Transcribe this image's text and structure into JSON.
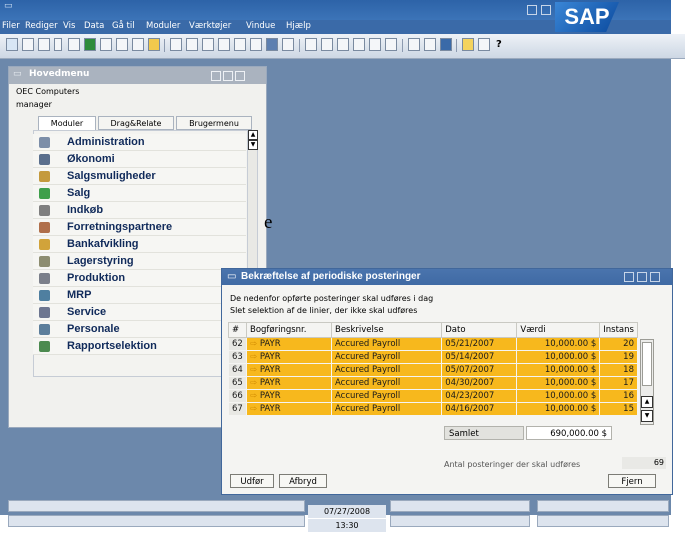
{
  "menubar": [
    "Filer",
    "Rediger",
    "Vis",
    "Data",
    "Gå til",
    "Moduler",
    "Værktøjer",
    "Vindue",
    "Hjælp"
  ],
  "brand": "SAP",
  "main_menu": {
    "title": "Hovedmenu",
    "company": "OEC Computers",
    "user": "manager",
    "tabs": [
      "Moduler",
      "Drag&Relate",
      "Brugermenu"
    ],
    "items": [
      "Administration",
      "Økonomi",
      "Salgsmuligheder",
      "Salg",
      "Indkøb",
      "Forretningspartnere",
      "Bankafvikling",
      "Lagerstyring",
      "Produktion",
      "MRP",
      "Service",
      "Personale",
      "Rapportselektion"
    ]
  },
  "edge_char": "e",
  "dialog": {
    "title": "Bekræftelse af periodiske posteringer",
    "line1": "De nedenfor opførte posteringer skal udføres i dag",
    "line2": "Slet selektion af de linier, der ikke skal udføres",
    "columns": [
      "#",
      "Bogføringsnr.",
      "Beskrivelse",
      "Dato",
      "Værdi",
      "Instans"
    ],
    "rows": [
      {
        "num": "62",
        "code": "PAYR",
        "desc": "Accured Payroll",
        "date": "05/21/2007",
        "value": "10,000.00 $",
        "inst": "20"
      },
      {
        "num": "63",
        "code": "PAYR",
        "desc": "Accured Payroll",
        "date": "05/14/2007",
        "value": "10,000.00 $",
        "inst": "19"
      },
      {
        "num": "64",
        "code": "PAYR",
        "desc": "Accured Payroll",
        "date": "05/07/2007",
        "value": "10,000.00 $",
        "inst": "18"
      },
      {
        "num": "65",
        "code": "PAYR",
        "desc": "Accured Payroll",
        "date": "04/30/2007",
        "value": "10,000.00 $",
        "inst": "17"
      },
      {
        "num": "66",
        "code": "PAYR",
        "desc": "Accured Payroll",
        "date": "04/23/2007",
        "value": "10,000.00 $",
        "inst": "16"
      },
      {
        "num": "67",
        "code": "PAYR",
        "desc": "Accured Payroll",
        "date": "04/16/2007",
        "value": "10,000.00 $",
        "inst": "15"
      }
    ],
    "total_label": "Samlet",
    "total_value": "690,000.00 $",
    "count_label": "Antal posteringer der skal udføres",
    "count_value": "69",
    "btn_run": "Udfør",
    "btn_cancel": "Afbryd",
    "btn_remove": "Fjern"
  },
  "status": {
    "date": "07/27/2008",
    "time": "13:30"
  },
  "colors": {
    "selected_row": "#f7b81d",
    "background": "#6c88ab",
    "titlebar": "#3f6aa4"
  }
}
